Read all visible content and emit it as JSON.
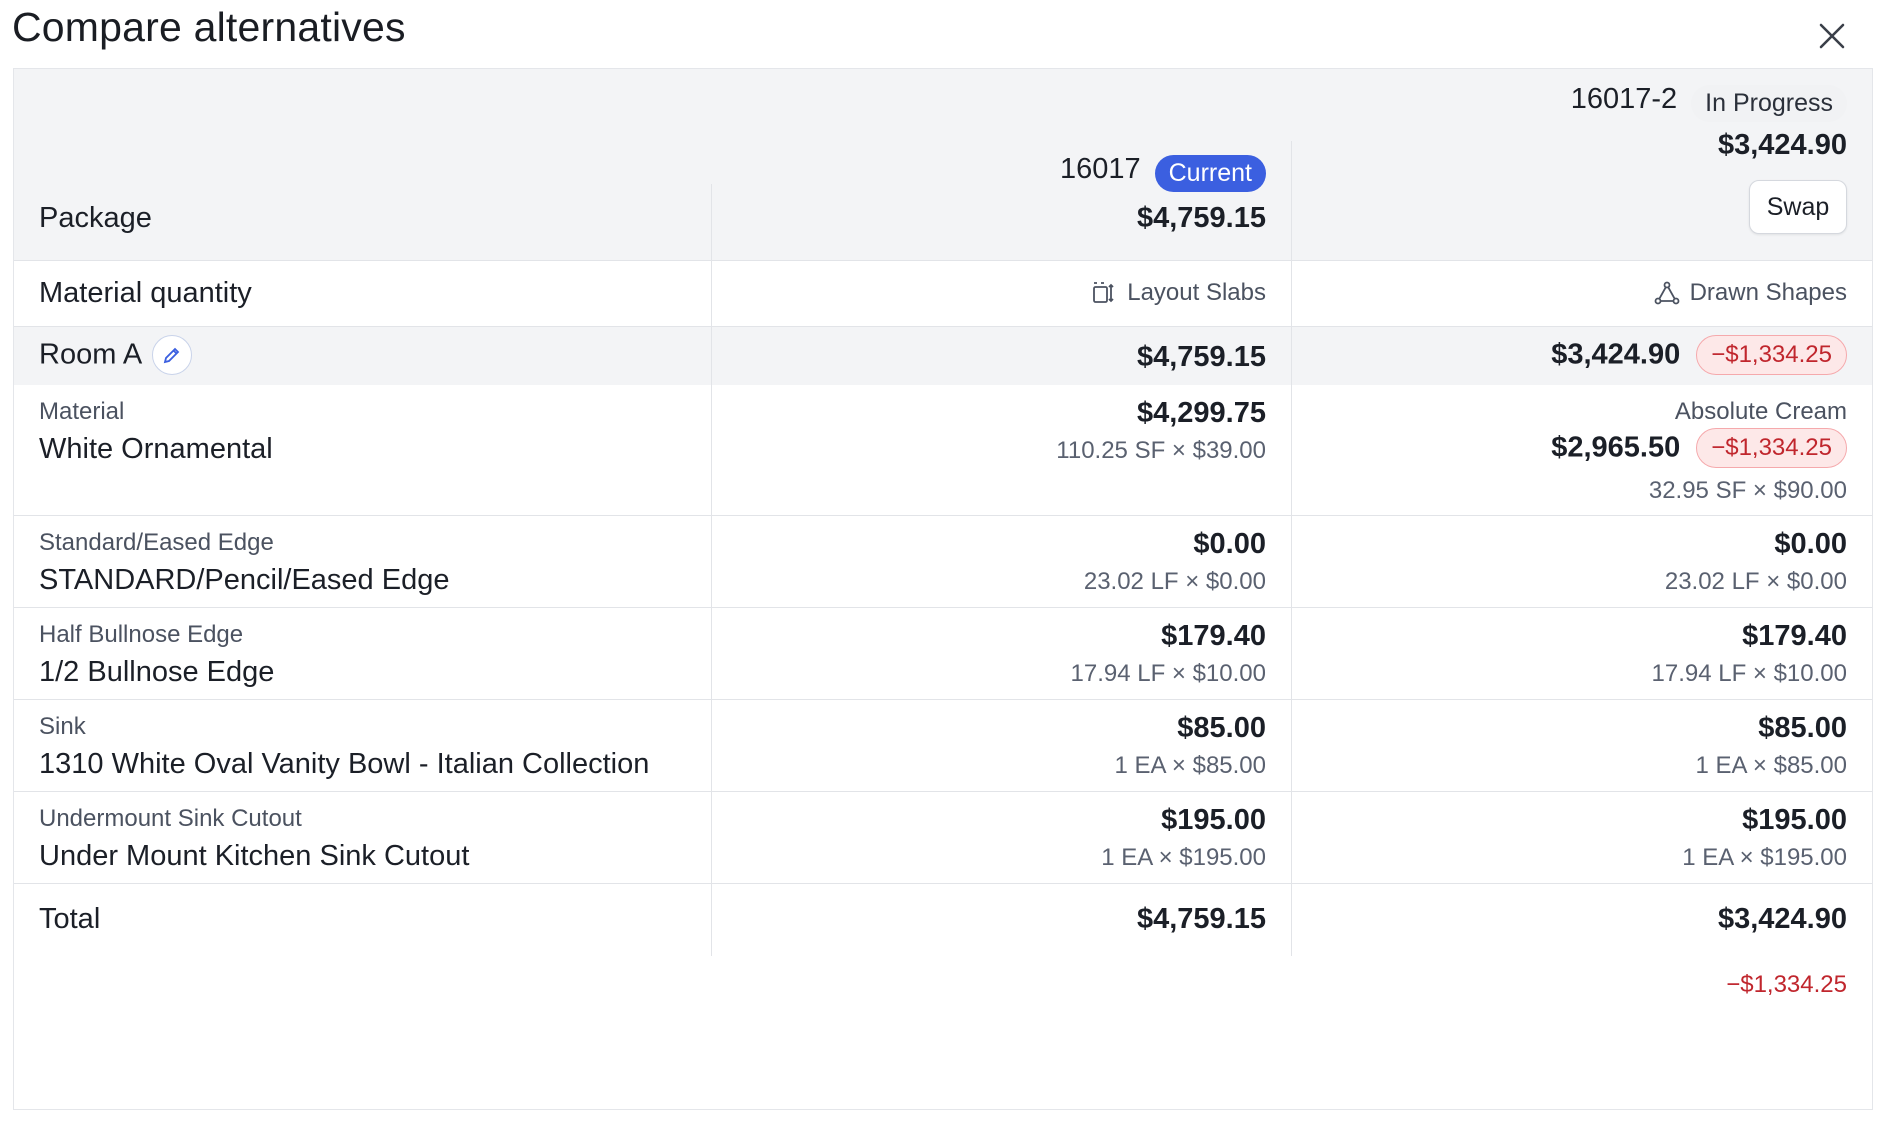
{
  "dialog": {
    "title": "Compare alternatives",
    "close_icon": "close-icon"
  },
  "header": {
    "package_label": "Package",
    "current": {
      "id": "16017",
      "badge": "Current",
      "price": "$4,759.15"
    },
    "alternative": {
      "id": "16017-2",
      "badge": "In Progress",
      "price": "$3,424.90",
      "swap_label": "Swap"
    }
  },
  "material_quantity": {
    "label": "Material quantity",
    "current": {
      "icon": "layout-slabs-icon",
      "text": "Layout Slabs"
    },
    "alternative": {
      "icon": "drawn-shapes-icon",
      "text": "Drawn Shapes"
    }
  },
  "room": {
    "name": "Room A",
    "current_total": "$4,759.15",
    "alternative_total": "$3,424.90",
    "alternative_diff": "−$1,334.25"
  },
  "lines": [
    {
      "category": "Material",
      "name": "White Ornamental",
      "current": {
        "amount": "$4,299.75",
        "detail": "110.25 SF × $39.00"
      },
      "alternative": {
        "name": "Absolute Cream",
        "amount": "$2,965.50",
        "diff": "−$1,334.25",
        "detail": "32.95 SF × $90.00"
      }
    },
    {
      "category": "Standard/Eased Edge",
      "name": "STANDARD/Pencil/Eased Edge",
      "current": {
        "amount": "$0.00",
        "detail": "23.02 LF × $0.00"
      },
      "alternative": {
        "amount": "$0.00",
        "detail": "23.02 LF × $0.00"
      }
    },
    {
      "category": "Half Bullnose Edge",
      "name": "1/2 Bullnose Edge",
      "current": {
        "amount": "$179.40",
        "detail": "17.94 LF × $10.00"
      },
      "alternative": {
        "amount": "$179.40",
        "detail": "17.94 LF × $10.00"
      }
    },
    {
      "category": "Sink",
      "name": "1310 White Oval Vanity Bowl - Italian Collection",
      "current": {
        "amount": "$85.00",
        "detail": "1 EA × $85.00"
      },
      "alternative": {
        "amount": "$85.00",
        "detail": "1 EA × $85.00"
      }
    },
    {
      "category": "Undermount Sink Cutout",
      "name": "Under Mount Kitchen Sink Cutout",
      "current": {
        "amount": "$195.00",
        "detail": "1 EA × $195.00"
      },
      "alternative": {
        "amount": "$195.00",
        "detail": "1 EA × $195.00"
      }
    }
  ],
  "total": {
    "label": "Total",
    "current": "$4,759.15",
    "alternative": "$3,424.90",
    "alternative_diff": "−$1,334.25"
  },
  "colors": {
    "current_badge": "#3b5fe0",
    "negative": "#c0262d",
    "header_bg": "#f3f4f6"
  }
}
